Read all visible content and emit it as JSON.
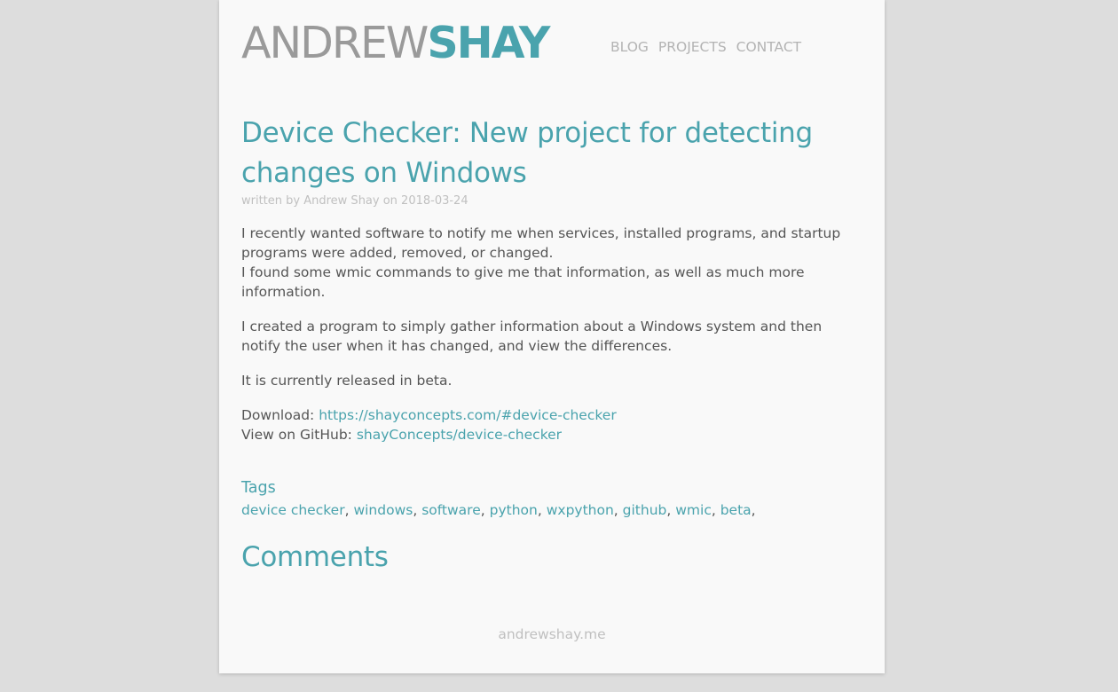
{
  "header": {
    "logo_first": "ANDREW",
    "logo_last": "SHAY",
    "nav": [
      "BLOG",
      "PROJECTS",
      "CONTACT"
    ]
  },
  "post": {
    "title": "Device Checker: New project for detecting changes on Windows",
    "byline": "written by Andrew Shay on 2018-03-24",
    "paragraph1_line1": "I recently wanted software to notify me when services, installed programs, and startup programs were added, removed, or changed.",
    "paragraph1_line2": "I found some wmic commands to give me that information, as well as much more information.",
    "paragraph2": "I created a program to simply gather information about a Windows system and then notify the user when it has changed, and view the differences.",
    "paragraph3": "It is currently released in beta.",
    "download_label": "Download: ",
    "download_link": "https://shayconcepts.com/#device-checker",
    "github_label": "View on GitHub: ",
    "github_link": "shayConcepts/device-checker"
  },
  "tags": {
    "heading": "Tags",
    "items": [
      "device checker",
      "windows",
      "software",
      "python",
      "wxpython",
      "github",
      "wmic",
      "beta"
    ]
  },
  "comments": {
    "heading": "Comments"
  },
  "footer": {
    "text": "andrewshay.me"
  },
  "colors": {
    "accent": "#4aa3ad",
    "muted": "#b3b3b3",
    "body_text": "#555555",
    "page_bg": "#f9f9f9",
    "outer_bg": "#dddddd"
  }
}
